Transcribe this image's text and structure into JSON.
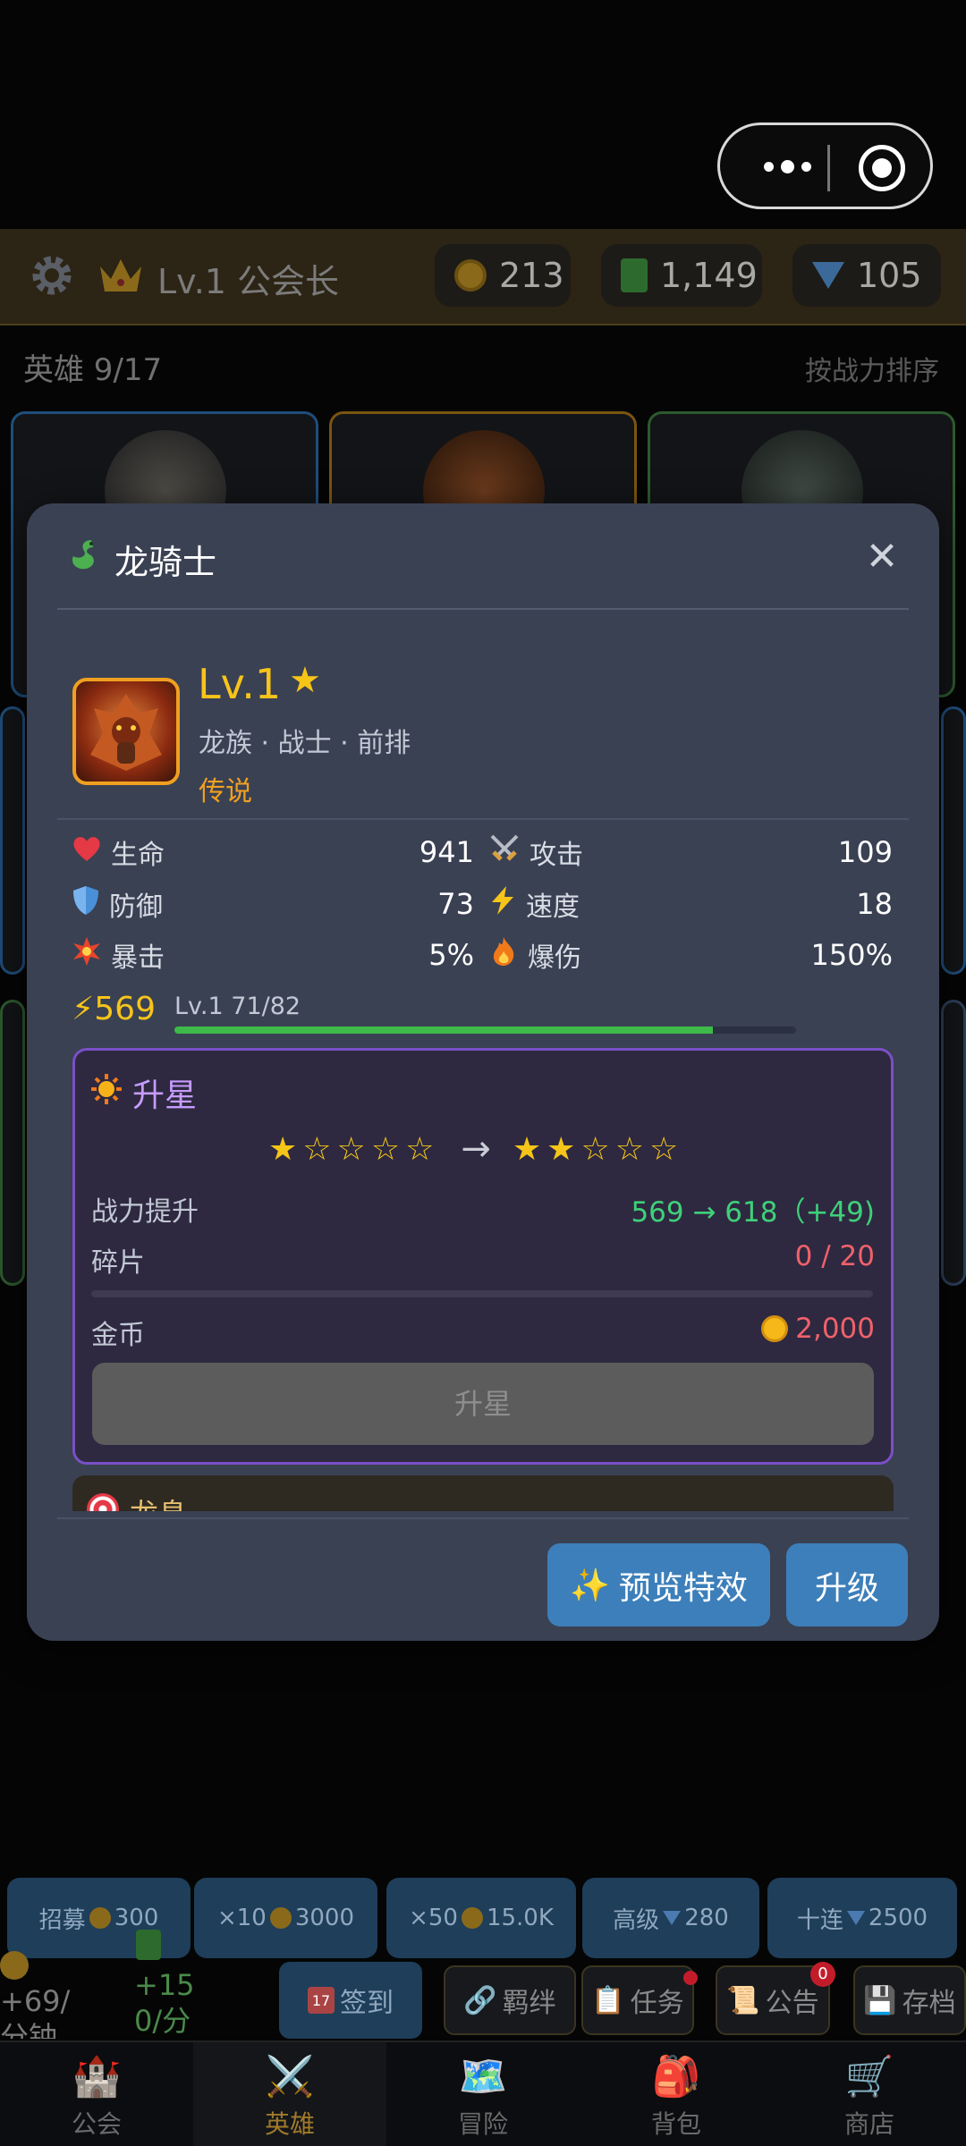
{
  "header": {
    "level_title": "Lv.1 公会长",
    "resources": [
      {
        "icon": "coin-icon",
        "value": "213"
      },
      {
        "icon": "book-icon",
        "value": "1,149"
      },
      {
        "icon": "diamond-icon",
        "value": "105"
      }
    ]
  },
  "hero_list": {
    "count_label": "英雄 9/17",
    "sort_label": "按战力排序"
  },
  "modal": {
    "title": "龙骑士",
    "hero": {
      "level": "Lv.1",
      "star_glyph": "★",
      "tags": "龙族 · 战士 · 前排",
      "rarity": "传说"
    },
    "stats": [
      {
        "icon": "heart-icon",
        "label": "生命",
        "value": "941"
      },
      {
        "icon": "swords-icon",
        "label": "攻击",
        "value": "109"
      },
      {
        "icon": "shield-icon",
        "label": "防御",
        "value": "73"
      },
      {
        "icon": "lightning-icon",
        "label": "速度",
        "value": "18"
      },
      {
        "icon": "burst-icon",
        "label": "暴击",
        "value": "5%"
      },
      {
        "icon": "fire-icon",
        "label": "爆伤",
        "value": "150%"
      }
    ],
    "power": "⚡569",
    "exp_label": "Lv.1  71/82",
    "exp_progress": 0.866,
    "star_up": {
      "title": "升星",
      "from_stars": "★☆☆☆☆",
      "to_stars": "★★☆☆☆",
      "arrow": "→",
      "power_label": "战力提升",
      "power_value": "569 → 618（+49)",
      "shards_label": "碎片",
      "shards_value": "0 / 20",
      "shards_progress": 0,
      "gold_label": "金币",
      "gold_value": "2,000",
      "button": "升星"
    },
    "next_section_peek": "龙息",
    "buttons": {
      "preview": "预览特效",
      "upgrade": "升级"
    }
  },
  "recruit": [
    {
      "label": "招募",
      "cost": "300"
    },
    {
      "label": "×10",
      "cost": "3000"
    },
    {
      "label": "×50",
      "cost": "15.0K"
    },
    {
      "label": "高级",
      "cost": "280"
    },
    {
      "label": "十连",
      "cost": "2500"
    }
  ],
  "income": {
    "gold_rate": "+69/",
    "gold_unit": "分钟",
    "book_rate": "+15",
    "book_unit": "0/分"
  },
  "quick_actions": [
    {
      "icon": "calendar-icon",
      "label": "签到"
    },
    {
      "icon": "link-icon",
      "label": "羁绊"
    },
    {
      "icon": "clipboard-icon",
      "label": "任务"
    },
    {
      "icon": "scroll-icon",
      "label": "公告",
      "badge": "0"
    },
    {
      "icon": "save-icon",
      "label": "存档"
    }
  ],
  "nav": [
    {
      "icon": "castle-icon",
      "label": "公会"
    },
    {
      "icon": "swords-icon",
      "label": "英雄"
    },
    {
      "icon": "map-icon",
      "label": "冒险"
    },
    {
      "icon": "backpack-icon",
      "label": "背包"
    },
    {
      "icon": "cart-icon",
      "label": "商店"
    }
  ],
  "colors": {
    "gold": "#f7c41a",
    "legendary": "#f0a020",
    "green_gain": "#3fd07a",
    "red_cost": "#f0616b",
    "purple": "#c69cff",
    "button_blue": "#3d7fba"
  }
}
